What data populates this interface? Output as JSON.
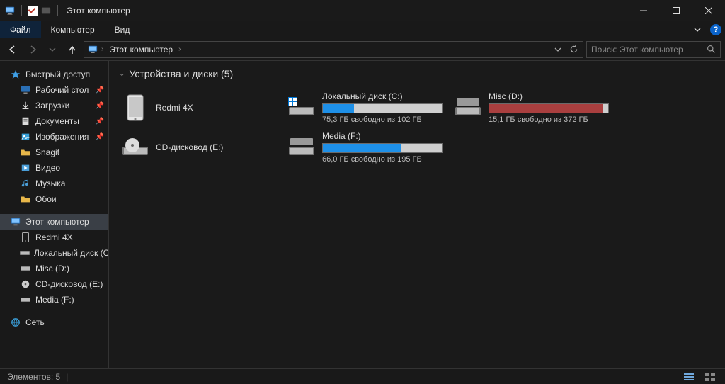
{
  "titlebar": {
    "title": "Этот компьютер"
  },
  "menubar": {
    "file": "Файл",
    "computer": "Компьютер",
    "view": "Вид"
  },
  "addressbar": {
    "location": "Этот компьютер"
  },
  "search": {
    "placeholder": "Поиск: Этот компьютер"
  },
  "sidebar": {
    "quick": {
      "label": "Быстрый доступ",
      "items": [
        {
          "label": "Рабочий стол",
          "icon": "desktop",
          "pinned": true
        },
        {
          "label": "Загрузки",
          "icon": "downloads",
          "pinned": true
        },
        {
          "label": "Документы",
          "icon": "documents",
          "pinned": true
        },
        {
          "label": "Изображения",
          "icon": "pictures",
          "pinned": true
        },
        {
          "label": "Snagit",
          "icon": "folder",
          "pinned": false
        },
        {
          "label": "Видео",
          "icon": "video",
          "pinned": false
        },
        {
          "label": "Музыка",
          "icon": "music",
          "pinned": false
        },
        {
          "label": "Обои",
          "icon": "folder",
          "pinned": false
        }
      ]
    },
    "thispc": {
      "label": "Этот компьютер",
      "items": [
        {
          "label": "Redmi 4X",
          "icon": "phone"
        },
        {
          "label": "Локальный диск (C:)",
          "icon": "disk"
        },
        {
          "label": "Misc (D:)",
          "icon": "disk"
        },
        {
          "label": "CD-дисковод (E:)",
          "icon": "cd"
        },
        {
          "label": "Media (F:)",
          "icon": "disk"
        }
      ]
    },
    "network": {
      "label": "Сеть"
    }
  },
  "main": {
    "section_title": "Устройства и диски (5)",
    "devices": [
      {
        "name": "Redmi 4X",
        "type": "phone"
      },
      {
        "name": "Локальный диск (C:)",
        "type": "disk-win",
        "free_text": "75,3 ГБ свободно из 102 ГБ",
        "fill_pct": 26,
        "bar_color": "#1e90e8"
      },
      {
        "name": "Misc (D:)",
        "type": "disk",
        "free_text": "15,1 ГБ свободно из 372 ГБ",
        "fill_pct": 96,
        "bar_color": "#a93f3f"
      },
      {
        "name": "CD-дисковод (E:)",
        "type": "cd"
      },
      {
        "name": "Media (F:)",
        "type": "disk",
        "free_text": "66,0 ГБ свободно из 195 ГБ",
        "fill_pct": 66,
        "bar_color": "#1e90e8"
      }
    ]
  },
  "statusbar": {
    "count_label": "Элементов: 5"
  }
}
